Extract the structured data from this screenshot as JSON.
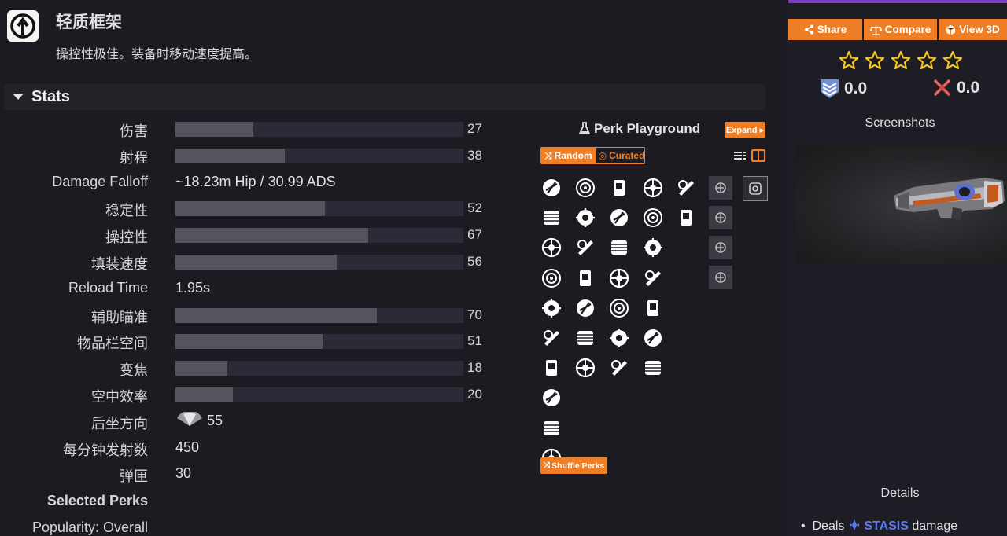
{
  "perk": {
    "title": "轻质框架",
    "description": "操控性极佳。装备时移动速度提高。",
    "icon": "arrow-circle-icon"
  },
  "stats_section": {
    "title": "Stats",
    "rows": [
      {
        "label": "伤害",
        "value": 27,
        "type": "bar"
      },
      {
        "label": "射程",
        "value": 38,
        "type": "bar"
      },
      {
        "label": "Damage Falloff",
        "text": "~18.23m Hip / 30.99 ADS",
        "type": "text"
      },
      {
        "label": "稳定性",
        "value": 52,
        "type": "bar"
      },
      {
        "label": "操控性",
        "value": 67,
        "type": "bar"
      },
      {
        "label": "填装速度",
        "value": 56,
        "type": "bar"
      },
      {
        "label": "Reload Time",
        "text": "1.95s",
        "type": "text"
      },
      {
        "label": "辅助瞄准",
        "value": 70,
        "type": "bar"
      },
      {
        "label": "物品栏空间",
        "value": 51,
        "type": "bar"
      },
      {
        "label": "变焦",
        "value": 18,
        "type": "bar"
      },
      {
        "label": "空中效率",
        "value": 20,
        "type": "bar"
      },
      {
        "label": "后坐方向",
        "text": "55",
        "type": "recoil"
      },
      {
        "label": "每分钟发射数",
        "text": "450",
        "type": "text"
      },
      {
        "label": "弹匣",
        "text": "30",
        "type": "text"
      }
    ],
    "selected_perks_label": "Selected Perks",
    "popularity_label": "Popularity: Overall"
  },
  "playground": {
    "title": "Perk Playground",
    "expand_label": "Expand ▸",
    "random_label": "Random",
    "curated_label": "Curated",
    "shuffle_label": "Shuffle Perks",
    "columns": [
      [
        "barrel-perk-icon",
        "magazine-perk-icon",
        "bullet-perk-icon",
        "scope-perk-icon",
        "ammo-perk-icon",
        "round-perk-icon",
        "cartridge-perk-icon",
        "stack-perk-icon",
        "shell-perk-icon",
        "slug-perk-icon"
      ],
      [
        "coil-perk-icon",
        "box-perk-icon",
        "bolt-perk-icon",
        "clip-perk-icon",
        "card-perk-icon",
        "sheet-perk-icon",
        "flask-perk-icon"
      ],
      [
        "target-perk-icon",
        "crosshair-perk-icon",
        "wing-perk-icon",
        "xmark-perk-icon",
        "skull-perk-icon",
        "hand-perk-icon",
        "shield-perk-icon"
      ],
      [
        "ring-perk-icon",
        "orbit-perk-icon",
        "arch-perk-icon",
        "totem-perk-icon",
        "mask-perk-icon",
        "knot-perk-icon",
        "rune-perk-icon"
      ],
      [
        "diamond-perk-icon",
        "clock-perk-icon"
      ]
    ],
    "mods": [
      "bug-mod-icon",
      "ship-mod-icon",
      "beetle-mod-icon",
      "clock-mod-icon"
    ],
    "masterwork": "square-masterwork-icon"
  },
  "right_panel": {
    "share_label": "Share",
    "compare_label": "Compare",
    "view3d_label": "View 3D",
    "stars": 5,
    "score_left": "0.0",
    "score_right": "0.0",
    "screenshots_label": "Screenshots",
    "details_label": "Details",
    "deals_prefix": "Deals",
    "deals_element": "STASIS",
    "deals_suffix": "damage"
  },
  "colors": {
    "accent": "#ee7f27",
    "stasis": "#5c7cf0",
    "bar_fill": "#55545e",
    "bar_track": "#2b2a37"
  }
}
